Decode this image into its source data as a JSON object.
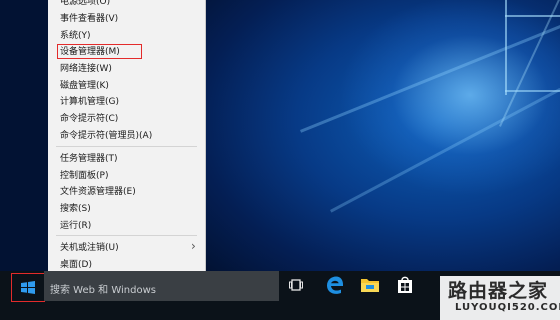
{
  "menu": {
    "items": [
      {
        "label": "电源选项(O)"
      },
      {
        "label": "事件查看器(V)"
      },
      {
        "label": "系统(Y)"
      },
      {
        "label": "设备管理器(M)"
      },
      {
        "label": "网络连接(W)"
      },
      {
        "label": "磁盘管理(K)"
      },
      {
        "label": "计算机管理(G)"
      },
      {
        "label": "命令提示符(C)"
      },
      {
        "label": "命令提示符(管理员)(A)"
      },
      {
        "label": "任务管理器(T)"
      },
      {
        "label": "控制面板(P)"
      },
      {
        "label": "文件资源管理器(E)"
      },
      {
        "label": "搜索(S)"
      },
      {
        "label": "运行(R)"
      },
      {
        "label": "关机或注销(U)"
      },
      {
        "label": "桌面(D)"
      }
    ],
    "highlighted_item": "设备管理器(M)",
    "submenu_arrow": "›"
  },
  "taskbar": {
    "search_placeholder": "搜索 Web 和 Windows",
    "start_icon": "windows-logo-icon",
    "pinned": [
      "task-view-icon",
      "edge-icon",
      "file-explorer-icon",
      "store-icon"
    ]
  },
  "watermark": {
    "cn": "路由器之家",
    "en": "LUYOUQI520.COM"
  },
  "colors": {
    "highlight_border": "#e32b2b",
    "menu_bg": "#f2f2f2",
    "taskbar_bg": "#0b1219",
    "edge_blue": "#1e8fe1",
    "explorer_yellow": "#f4c430"
  }
}
